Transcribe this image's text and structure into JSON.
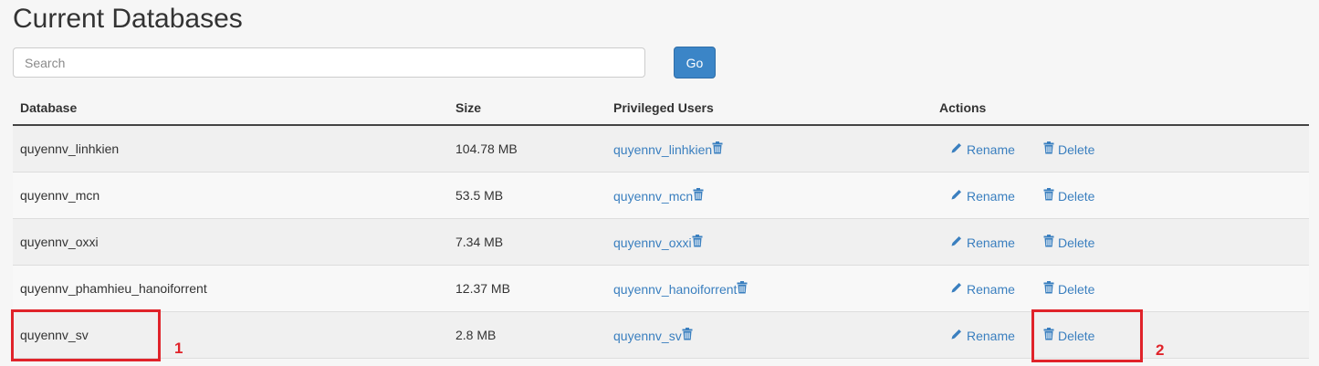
{
  "page_title": "Current Databases",
  "search": {
    "placeholder": "Search",
    "value": ""
  },
  "go_label": "Go",
  "columns": {
    "database": "Database",
    "size": "Size",
    "users": "Privileged Users",
    "actions": "Actions"
  },
  "actions": {
    "rename": "Rename",
    "delete": "Delete"
  },
  "rows": [
    {
      "database": "quyennv_linhkien",
      "size": "104.78 MB",
      "user": "quyennv_linhkien"
    },
    {
      "database": "quyennv_mcn",
      "size": "53.5 MB",
      "user": "quyennv_mcn"
    },
    {
      "database": "quyennv_oxxi",
      "size": "7.34 MB",
      "user": "quyennv_oxxi"
    },
    {
      "database": "quyennv_phamhieu_hanoiforrent",
      "size": "12.37 MB",
      "user": "quyennv_hanoiforrent"
    },
    {
      "database": "quyennv_sv",
      "size": "2.8 MB",
      "user": "quyennv_sv"
    }
  ],
  "annotations": {
    "marker_1": "1",
    "marker_2": "2"
  },
  "colors": {
    "link": "#3a7fbf",
    "button": "#3b85c7",
    "highlight": "#e0232a"
  },
  "icons": {
    "user_remove": "trash-icon",
    "rename": "pencil-icon",
    "delete": "trash-icon"
  }
}
